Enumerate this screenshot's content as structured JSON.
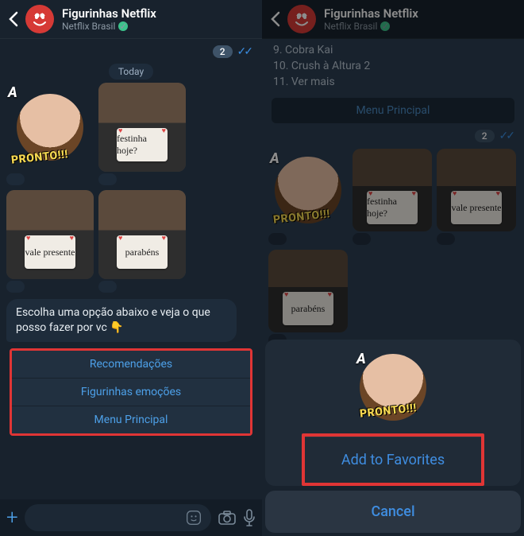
{
  "header": {
    "title": "Figurinhas Netflix",
    "subtitle": "Netflix Brasil"
  },
  "badge": {
    "count": "2"
  },
  "date": "Today",
  "stickers": {
    "a_label": "A",
    "pronto": "PRONTO!!!",
    "festinha": "festinha hoje?",
    "vale": "vale presente",
    "parabens": "parabéns"
  },
  "message": {
    "text": "Escolha uma opção abaixo e veja o que posso fazer por vc",
    "emoji": "👇"
  },
  "options": {
    "recs": "Recomendações",
    "emojis": "Figurinhas emoções",
    "menu": "Menu Principal"
  },
  "right": {
    "items": {
      "nine": "9. Cobra Kai",
      "ten": "10. Crush à Altura 2",
      "eleven": "11. Ver mais"
    },
    "menu_btn": "Menu Principal"
  },
  "modal": {
    "fav": "Add to Favorites",
    "cancel": "Cancel"
  }
}
